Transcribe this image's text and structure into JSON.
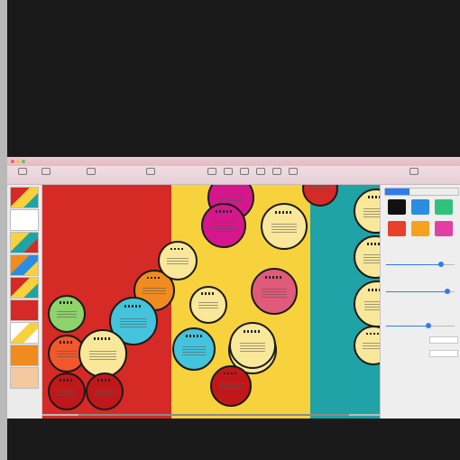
{
  "app": {
    "window_title": ""
  },
  "toolbar": {
    "items": [
      "",
      "",
      "",
      "",
      "",
      "",
      "",
      "",
      "",
      "",
      ""
    ]
  },
  "thumbnails": [
    {
      "colors": [
        "#d52a25",
        "#f7d23c",
        "#1fa3a6"
      ]
    },
    {
      "colors": [
        "#ffffff",
        "#ffffff",
        "#ffffff"
      ]
    },
    {
      "colors": [
        "#f7d23c",
        "#1fa3a6",
        "#d52a25"
      ]
    },
    {
      "colors": [
        "#f08b1f",
        "#2b8de0",
        "#f7d23c"
      ]
    },
    {
      "colors": [
        "#d52a25",
        "#f7d23c",
        "#1fa3a6"
      ]
    },
    {
      "colors": [
        "#d52a25",
        "#d52a25",
        "#d52a25"
      ]
    },
    {
      "colors": [
        "#ffffff",
        "#f7d23c",
        "#ffffff"
      ]
    },
    {
      "colors": [
        "#f08b1f",
        "#f08b1f",
        "#f08b1f"
      ]
    },
    {
      "colors": [
        "#f4c9a0",
        "#f4c9a0",
        "#f4c9a0"
      ]
    }
  ],
  "canvas": {
    "bands": {
      "red": "#d52a25",
      "yellow": "#f7d23c",
      "teal": "#1fa3a6"
    },
    "bubbles": [
      {
        "color": "#d6168c"
      },
      {
        "color": "#d6168c"
      },
      {
        "color": "#f9e79a"
      },
      {
        "color": "#e05a7a"
      },
      {
        "color": "#f9e79a"
      },
      {
        "color": "#f08b1f"
      },
      {
        "color": "#43c4dc"
      },
      {
        "color": "#8fd36b"
      },
      {
        "color": "#f2582a"
      },
      {
        "color": "#f9e79a"
      },
      {
        "color": "#c0181a"
      },
      {
        "color": "#c0181a"
      },
      {
        "color": "#f9e79a"
      },
      {
        "color": "#e3647f"
      },
      {
        "color": "#f9e79a"
      },
      {
        "color": "#43c4dc"
      },
      {
        "color": "#f9e79a"
      },
      {
        "color": "#c0181a"
      },
      {
        "color": "#d52a25"
      },
      {
        "color": "#f9e79a"
      },
      {
        "color": "#f9e79a"
      },
      {
        "color": "#f9e79a"
      },
      {
        "color": "#f9e79a"
      }
    ]
  },
  "inspector": {
    "tabs": [
      "",
      "",
      ""
    ],
    "swatches": [
      {
        "color": "#111111",
        "label": ""
      },
      {
        "color": "#2b8de0",
        "label": ""
      },
      {
        "color": "#2fc27a",
        "label": ""
      },
      {
        "color": "#e8402a",
        "label": ""
      },
      {
        "color": "#f6a21e",
        "label": ""
      },
      {
        "color": "#e23fa6",
        "label": ""
      }
    ],
    "rows": [
      "",
      "",
      "",
      "",
      "",
      "",
      "",
      ""
    ],
    "accent": "#2f7bf0"
  }
}
